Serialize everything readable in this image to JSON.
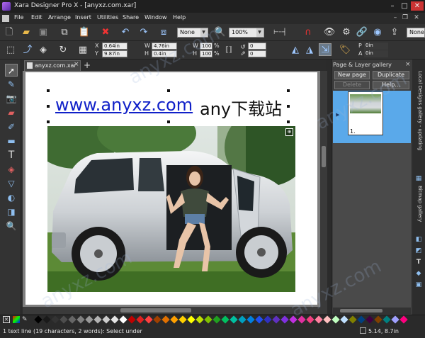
{
  "window": {
    "title": "Xara Designer Pro X - [anyxz.com.xar]",
    "minimize": "–",
    "maximize": "□",
    "close": "✕"
  },
  "menu": [
    "File",
    "Edit",
    "Arrange",
    "Insert",
    "Utilities",
    "Share",
    "Window",
    "Help"
  ],
  "toolbar1": {
    "feather_combo": "None",
    "zoom_combo": "100%",
    "right_combo": "None"
  },
  "toolbar2": {
    "x_label": "X",
    "x_value": "0.64in",
    "y_label": "Y",
    "y_value": "9.87in",
    "w_label": "W",
    "w_value": "4.76in",
    "h_label": "H",
    "h_value": "0.4in",
    "w_pct_label": "W",
    "w_pct": "100",
    "h_pct_label": "H",
    "h_pct": "100",
    "pct_symbol": "%",
    "rot_value": "0",
    "skew_value": "0",
    "p_label": "P",
    "p_value": "0in",
    "a_label": "A",
    "a_value": "0in"
  },
  "document": {
    "tab_label": "anyxz.com.xar",
    "tab_close": "×",
    "tab_add": "+",
    "link_text": "www.anyxz.com",
    "brand_text": "any下载站"
  },
  "gallery": {
    "title": "Page & Layer gallery",
    "close": "×",
    "new_page": "New page",
    "duplicate": "Duplicate",
    "delete": "Delete",
    "help": "Help...",
    "page_number": "1."
  },
  "side_tabs": [
    "Local Designs gallery - updating",
    "Bitmap gallery"
  ],
  "status": {
    "text": "1 text line (19 characters, 2 words): Select under",
    "coords": "5.14, 8.7in"
  },
  "watermark": "anyxz.com",
  "colors": {
    "palette": [
      "#000000",
      "#1a1a1a",
      "#333333",
      "#4d4d4d",
      "#666666",
      "#808080",
      "#999999",
      "#b3b3b3",
      "#cccccc",
      "#e6e6e6",
      "#ffffff",
      "#c00000",
      "#e02020",
      "#ff4040",
      "#a04000",
      "#e07000",
      "#ffa000",
      "#ffd000",
      "#ffff00",
      "#c0e000",
      "#80c000",
      "#20a020",
      "#00c060",
      "#00c0a0",
      "#00a0c0",
      "#0080e0",
      "#2050f0",
      "#3030c0",
      "#6030c0",
      "#8030e0",
      "#c030e0",
      "#e030a0",
      "#f04080",
      "#ff80a0",
      "#ffc0c0",
      "#c0ffc0",
      "#c0e0ff",
      "#808000",
      "#004080",
      "#400040",
      "#804000",
      "#008080",
      "#a0a0ff",
      "#ff0080"
    ],
    "accent": "#5aa9ea",
    "link": "#1020c8"
  }
}
